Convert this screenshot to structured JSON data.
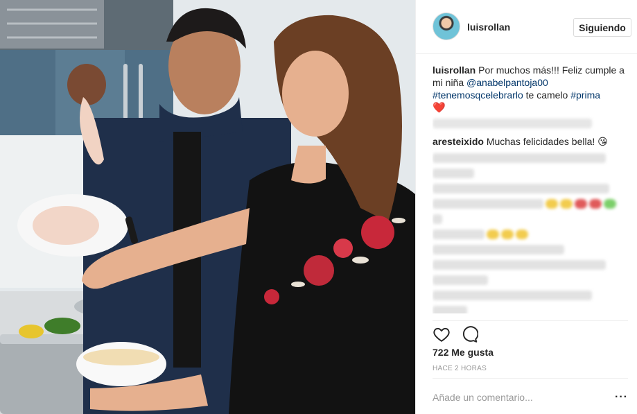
{
  "post": {
    "username": "luisrollan",
    "follow_label": "Siguiendo",
    "caption": {
      "username": "luisrollan",
      "text_1": " Por muchos más!!! Feliz cumple a mi niña ",
      "mention": "@anabelpantoja00",
      "hashtag_1": "#tenemosqcelebrarlo",
      "text_2": " te camelo ",
      "hashtag_2": "#prima",
      "emoji": "❤️"
    },
    "comments": [
      {
        "username": "aresteixido",
        "text": " Muchas felicidades bella! 😘"
      }
    ],
    "likes_label": "722 Me gusta",
    "time_label": "HACE 2 HORAS",
    "add_comment_placeholder": "Añade un comentario...",
    "more_label": "···"
  },
  "icons": {
    "like": "heart-outline-icon",
    "comment": "speech-bubble-icon",
    "more": "more-dots-icon"
  },
  "colors": {
    "link": "#003569",
    "text": "#262626",
    "muted": "#999999",
    "border": "#efefef"
  }
}
